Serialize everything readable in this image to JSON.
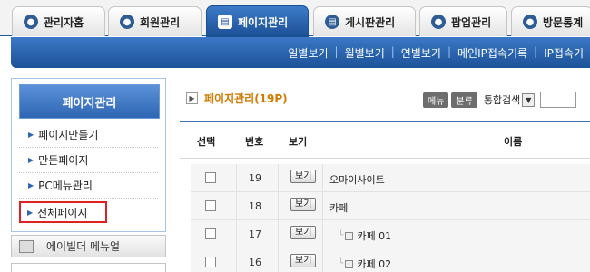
{
  "tabs": [
    {
      "label": "관리자홈",
      "icon": "person-icon",
      "active": false
    },
    {
      "label": "회원관리",
      "icon": "members-icon",
      "active": false
    },
    {
      "label": "페이지관리",
      "icon": "page-icon",
      "active": true
    },
    {
      "label": "게시판관리",
      "icon": "board-icon",
      "active": false
    },
    {
      "label": "팝업관리",
      "icon": "popup-icon",
      "active": false
    },
    {
      "label": "방문통계",
      "icon": "stats-icon",
      "active": false
    }
  ],
  "subnav": [
    "일별보기",
    "월별보기",
    "연별보기",
    "메인IP접속기록",
    "IP접속기"
  ],
  "sidebar": {
    "title": "페이지관리",
    "items": [
      "페이지만들기",
      "만든페이지",
      "PC메뉴관리",
      "전체페이지"
    ],
    "manual_label": "에이빌더 메뉴얼"
  },
  "main": {
    "title": "페이지관리(19P)",
    "btn_menu": "메뉴",
    "btn_category": "분류",
    "search_select": "통합검색"
  },
  "table": {
    "headers": [
      "선택",
      "번호",
      "보기",
      "이름"
    ],
    "view_label": "보기",
    "rows": [
      {
        "num": "19",
        "name": "오마이사이트",
        "child": false
      },
      {
        "num": "18",
        "name": "카페",
        "child": false
      },
      {
        "num": "17",
        "name": "카페 01",
        "child": true
      },
      {
        "num": "16",
        "name": "카페 02",
        "child": true
      }
    ]
  },
  "colors": {
    "accent": "#1c5298",
    "title": "#d07a00",
    "highlight_border": "#dd2222"
  }
}
